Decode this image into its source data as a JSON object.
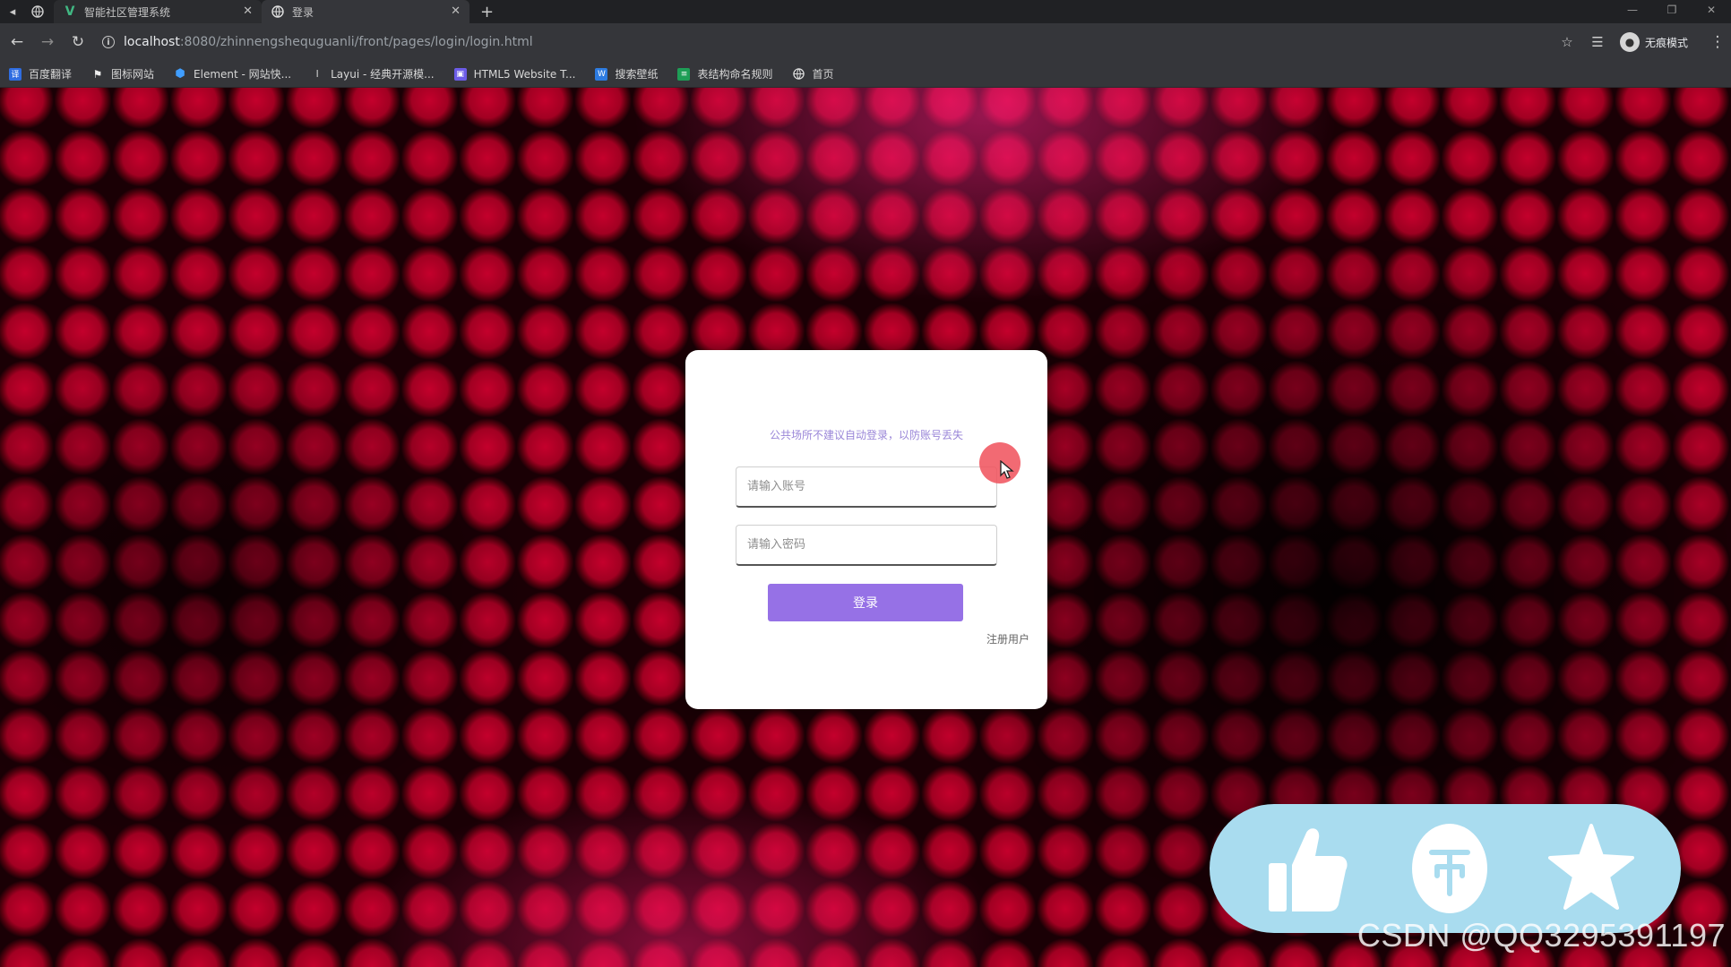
{
  "browser": {
    "tabs": [
      {
        "title": "智能社区管理系统",
        "icon": "vue-logo-icon"
      },
      {
        "title": "登录",
        "icon": "globe-icon"
      }
    ],
    "url": {
      "host": "localhost",
      "path": ":8080/zhinnengshequguanli/front/pages/login/login.html"
    },
    "profile_label": "无痕模式",
    "bookmarks": [
      {
        "label": "百度翻译",
        "icon": "baidu-translate-icon",
        "color": "#2f6de1"
      },
      {
        "label": "图标网站",
        "icon": "flag-icon",
        "color": "#444444"
      },
      {
        "label": "Element - 网站快...",
        "icon": "element-hexagon-icon",
        "color": "#409eff"
      },
      {
        "label": "Layui - 经典开源模...",
        "icon": "layui-icon",
        "color": "#555555"
      },
      {
        "label": "HTML5 Website T...",
        "icon": "html5-template-icon",
        "color": "#6c5ce7"
      },
      {
        "label": "搜索壁纸",
        "icon": "wallpaper-icon",
        "color": "#2d7be0"
      },
      {
        "label": "表结构命名规则",
        "icon": "sheet-icon",
        "color": "#1e9e56"
      },
      {
        "label": "首页",
        "icon": "globe-icon",
        "color": "#666666"
      }
    ]
  },
  "login": {
    "hint": "公共场所不建议自动登录，以防账号丢失",
    "username_placeholder": "请输入账号",
    "password_placeholder": "请输入密码",
    "login_button": "登录",
    "register_link": "注册用户",
    "accent_color": "#9671e6"
  },
  "overlay": {
    "icons": [
      "thumbs-up-icon",
      "coin-icon",
      "star-icon"
    ],
    "watermark": "CSDN @QQ3295391197"
  }
}
